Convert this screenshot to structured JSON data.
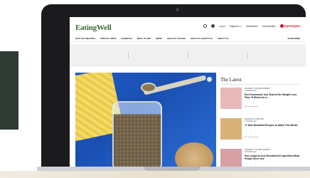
{
  "site": {
    "logo": "EatingWell",
    "header_links": [
      "Log in",
      "Magazine ∨",
      "Newsletters",
      "Sweepstakes"
    ],
    "brand": "myrecipes"
  },
  "nav": {
    "items": [
      "HEALTHY RECIPES",
      "SPECIAL DIETS",
      "DIABETES",
      "MEAL PLANS",
      "NEWS",
      "HEALTHY EATING",
      "HEALTHY LIFESTYLE",
      "ABOUT US"
    ],
    "subscribe": "SUBSCRIBE"
  },
  "latest": {
    "title": "The Latest",
    "items": [
      {
        "category": "CELEBRITY & ENTERTAINMENT",
        "time": "5 HOURS AGO",
        "headline": "Ree Drummond Just Shared Her Weight Loss Plan “It Works for a…",
        "byline": "By Danielle Hildreth",
        "thumb_color": "#e9b9b9"
      },
      {
        "category": "BREAKFAST & BRUNCH",
        "time": "5 HOURS AGO",
        "headline": "17 New Breakfast Recipes to Make This Month",
        "byline": "By Carolyn Malcoun",
        "thumb_color": "#d9b27a"
      },
      {
        "category": "CELEBRITY & ENTERTAINMENT",
        "time": "5 HOURS AGO",
        "headline": "Eva Longoria Just Revealed the Ingredient Most People Don't Use",
        "byline": "",
        "thumb_color": "#d6a0a4"
      }
    ]
  },
  "colors": {
    "logo_green": "#3a6b36",
    "brand_red": "#c8102e",
    "hero_blue": "#1f5dc9"
  }
}
